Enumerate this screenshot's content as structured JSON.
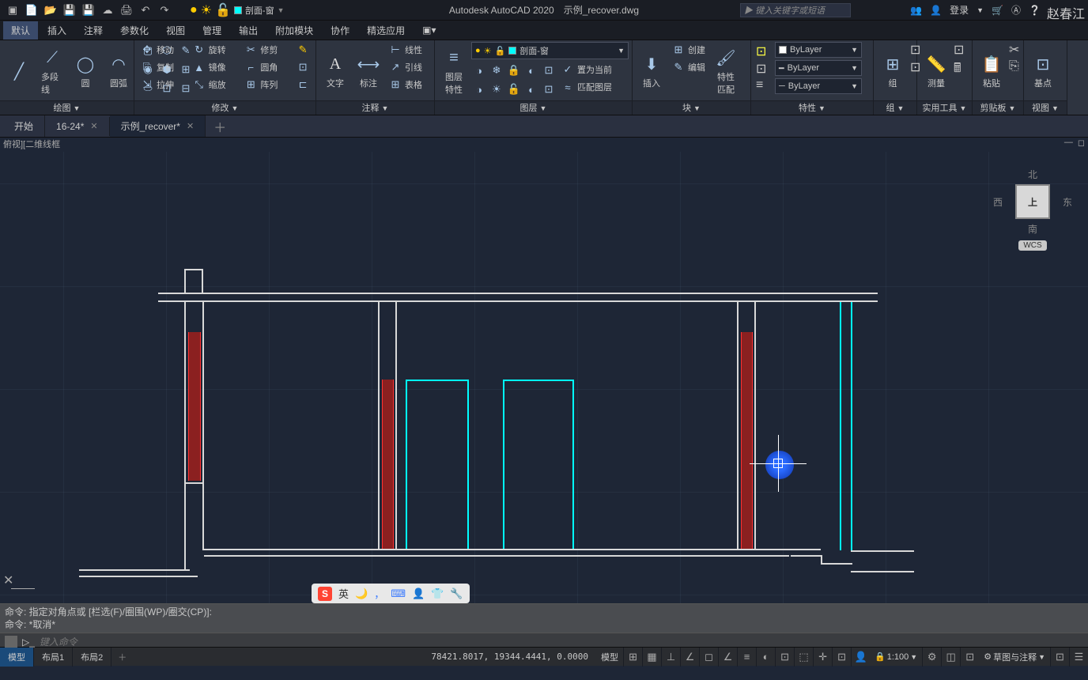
{
  "app_title": "Autodesk AutoCAD 2020",
  "doc_name": "示例_recover.dwg",
  "search_placeholder": "键入关键字或短语",
  "login_label": "登录",
  "watermark": "赵春江",
  "menu": {
    "default": "默认",
    "insert": "插入",
    "annotate": "注释",
    "param": "参数化",
    "view": "视图",
    "manage": "管理",
    "output": "输出",
    "addon": "附加模块",
    "collab": "协作",
    "featured": "精选应用"
  },
  "ribbon": {
    "draw": {
      "title": "绘图",
      "polyline": "多段线",
      "circle": "圆",
      "arc": "圆弧"
    },
    "modify": {
      "title": "修改",
      "move": "移动",
      "rotate": "旋转",
      "trim": "修剪",
      "copy": "复制",
      "mirror": "镜像",
      "fillet": "圆角",
      "stretch": "拉伸",
      "scale": "缩放",
      "array": "阵列"
    },
    "annot": {
      "title": "注释",
      "text": "文字",
      "dim": "标注",
      "linear": "线性",
      "leader": "引线",
      "table": "表格"
    },
    "layers": {
      "title": "图层",
      "props": "图层\n特性",
      "current": "剖面-窗",
      "setcur": "置为当前",
      "match": "匹配图层"
    },
    "block": {
      "title": "块",
      "insert": "插入",
      "create": "创建",
      "edit": "编辑",
      "attr": "特性\n匹配"
    },
    "props": {
      "title": "特性",
      "bylayer": "ByLayer"
    },
    "group": {
      "title": "组",
      "label": "组"
    },
    "util": {
      "title": "实用工具",
      "measure": "测量"
    },
    "clip": {
      "title": "剪贴板",
      "paste": "粘贴"
    },
    "view": {
      "title": "视图",
      "base": "基点"
    }
  },
  "tabs": {
    "start": "开始",
    "t1": "16-24*",
    "t2": "示例_recover*"
  },
  "viewport_label": "俯视][二维线框",
  "viewcube": {
    "n": "北",
    "s": "南",
    "e": "东",
    "w": "西",
    "top": "上",
    "wcs": "WCS"
  },
  "ime_lang": "英",
  "cmd": {
    "line1": "命令: 指定对角点或 [栏选(F)/圈围(WP)/圈交(CP)]:",
    "line2": "命令: *取消*",
    "placeholder": "键入命令"
  },
  "status": {
    "model": "模型",
    "layout1": "布局1",
    "layout2": "布局2",
    "coords": "78421.8017, 19344.4441, 0.0000",
    "space": "模型",
    "scale": "1:100",
    "workspace": "草图与注释"
  }
}
